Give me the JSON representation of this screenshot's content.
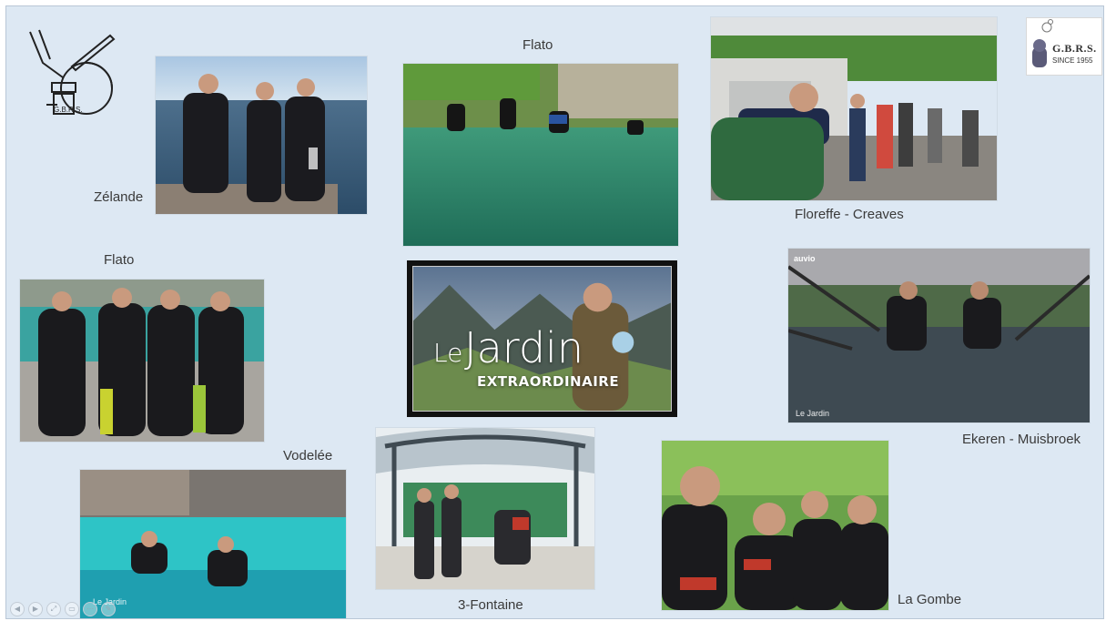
{
  "captions": {
    "zelande": "Zélande",
    "flato_top": "Flato",
    "floreffe": "Floreffe - Creaves",
    "flato_left": "Flato",
    "vodelee": "Vodelée",
    "ekeren": "Ekeren - Muisbroek",
    "fontaine": "3-Fontaine",
    "gombe": "La Gombe"
  },
  "logo": {
    "name": "G.B.R.S.",
    "since": "SINCE 1955"
  },
  "featured": {
    "le": "Le",
    "jardin": "Jardin",
    "extra": "EXTRAORDINAIRE"
  },
  "watermarks": {
    "ekeren_top": "auvio",
    "ekeren_bottom": "Le Jardin",
    "vodelee": "Le Jardin"
  },
  "controls": [
    "◀",
    "▶",
    "⤢",
    "▭",
    "⋯",
    "✎"
  ],
  "colors": {
    "slide_bg": "#dde8f3",
    "water_green": "#3f9a7a",
    "water_turquoise": "#2ec4c6",
    "sky": "#c9d9e8",
    "foliage": "#4f8a3a"
  }
}
